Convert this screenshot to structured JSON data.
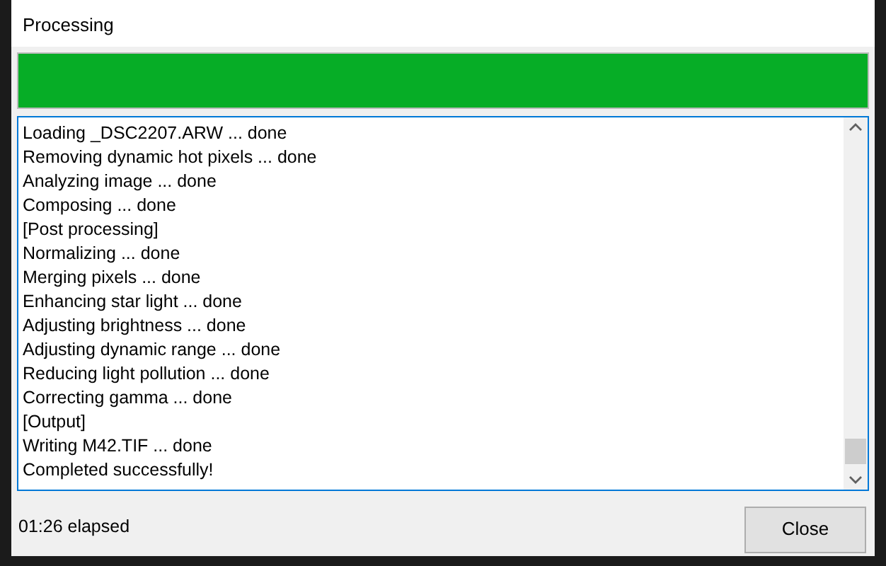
{
  "window": {
    "title": "Processing"
  },
  "progress": {
    "level": 1
  },
  "log": {
    "lines": [
      "Loading _DSC2207.ARW ... done",
      "Removing dynamic hot pixels ... done",
      "Analyzing image ... done",
      "Composing ... done",
      "[Post processing]",
      "Normalizing ... done",
      "Merging pixels ... done",
      "Enhancing star light ... done",
      "Adjusting brightness ... done",
      "Adjusting dynamic range ... done",
      "Reducing light pollution ... done",
      "Correcting gamma ... done",
      "[Output]",
      "Writing M42.TIF ... done",
      "Completed successfully!"
    ]
  },
  "status": "01:26 elapsed",
  "buttons": [
    "Close"
  ]
}
